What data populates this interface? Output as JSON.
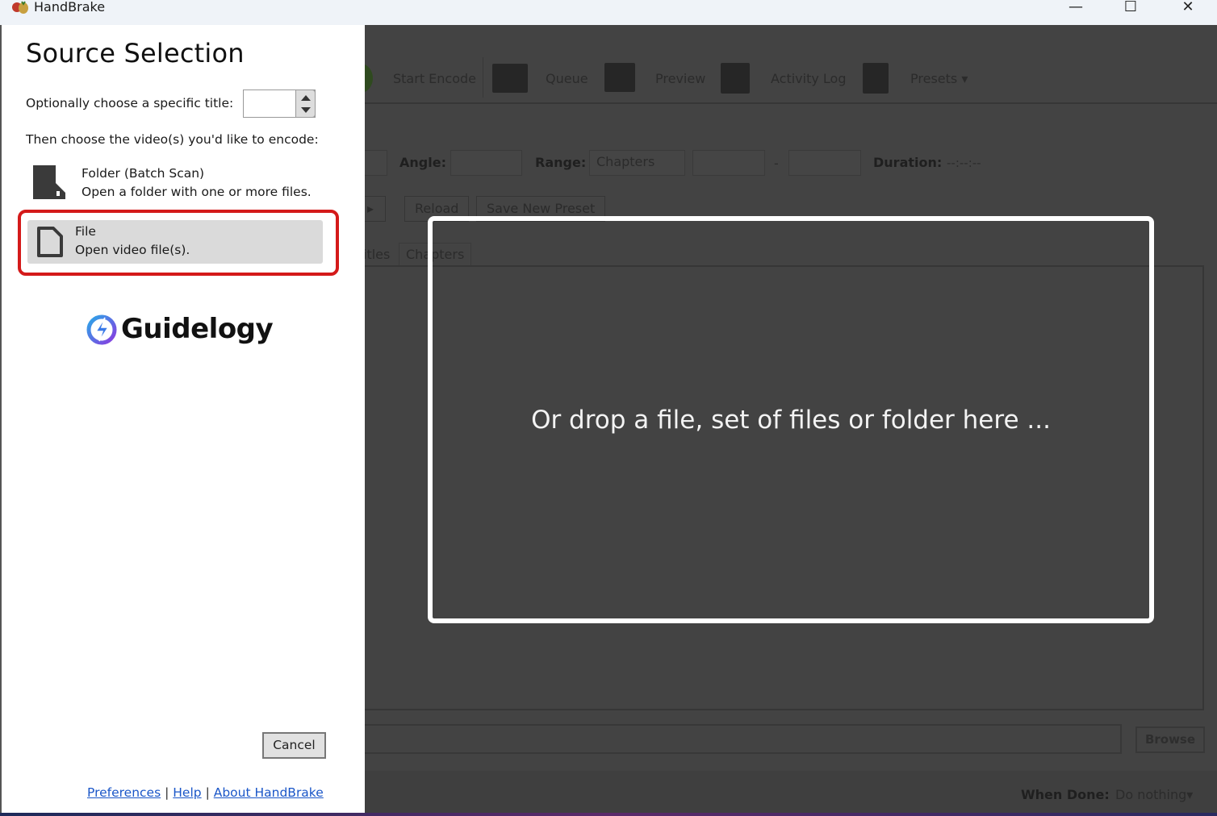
{
  "window": {
    "title": "HandBrake",
    "minimize": "—",
    "maximize": "☐",
    "close": "✕"
  },
  "dialog": {
    "title": "Source Selection",
    "title_prompt": "Optionally choose a specific title:",
    "title_value": "",
    "encode_prompt": "Then choose the video(s) you'd like to encode:",
    "options": [
      {
        "title": "Folder (Batch Scan)",
        "description": "Open a folder with one or more files.",
        "icon": "folder-icon"
      },
      {
        "title": "File",
        "description": "Open video file(s).",
        "icon": "file-icon"
      }
    ],
    "highlight_color": "#d41a1a",
    "watermark": "Guidelogy",
    "cancel": "Cancel",
    "links": [
      "Preferences",
      "Help",
      "About HandBrake"
    ],
    "separator": "|"
  },
  "toolbar": {
    "start_encode": "Start Encode",
    "queue": "Queue",
    "preview": "Preview",
    "activity_log": "Activity Log",
    "presets": "Presets"
  },
  "source_row": {
    "angle_label": "Angle:",
    "range_label": "Range:",
    "range_value": "Chapters",
    "dash": "-",
    "duration_label": "Duration:",
    "duration_value": "--:--:--"
  },
  "preset_buttons": {
    "reload": "Reload",
    "save_new": "Save New Preset"
  },
  "tabs": [
    "itles",
    "Chapters"
  ],
  "dropzone": {
    "text": "Or drop a file, set of files or folder here ..."
  },
  "destination": {
    "browse": "Browse"
  },
  "footer": {
    "when_done_label": "When Done:",
    "when_done_value": "Do nothing"
  }
}
